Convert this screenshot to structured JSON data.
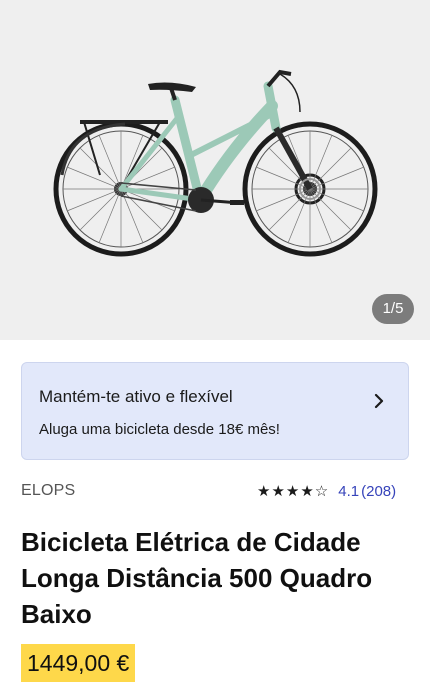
{
  "gallery": {
    "counter": "1/5"
  },
  "promo": {
    "title": "Mantém-te ativo e flexível",
    "subtitle": "Aluga uma bicicleta desde 18€ mês!"
  },
  "product": {
    "brand": "ELOPS",
    "rating": {
      "stars": "★★★★☆",
      "value": 4.1,
      "value_text": "4.1",
      "count_text": "(208)"
    },
    "title": "Bicicleta Elétrica de Cidade Longa Distância 500 Quadro Baixo",
    "price": "1449,00 €"
  },
  "colors": {
    "accent_blue": "#3643ba",
    "price_highlight": "#fed84a",
    "promo_bg": "#e2e8fa",
    "frame": "#9cc9b7"
  },
  "icons": {
    "promo_arrow": "chevron-right-icon",
    "rating": "star-icon"
  }
}
